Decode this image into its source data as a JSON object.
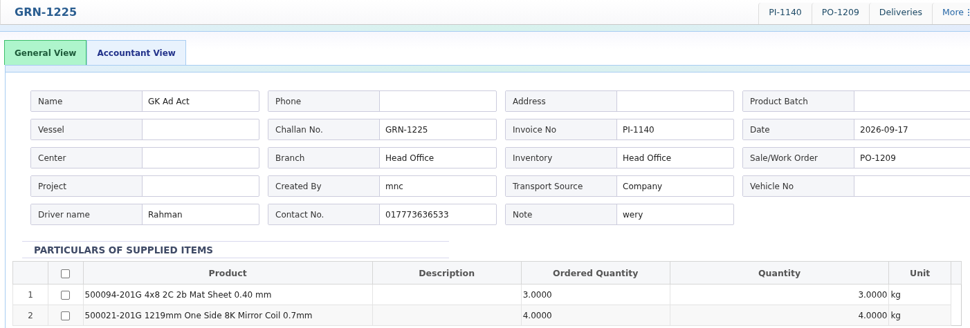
{
  "header": {
    "title": "GRN-1225",
    "links": [
      {
        "label": "PI-1140",
        "kind": "link"
      },
      {
        "label": "PO-1209",
        "kind": "link"
      },
      {
        "label": "Deliveries",
        "kind": "link"
      },
      {
        "label": "More",
        "kind": "menu"
      }
    ]
  },
  "tabs": [
    {
      "label": "General View",
      "selected": true
    },
    {
      "label": "Accountant View",
      "selected": false
    }
  ],
  "fields": [
    {
      "label": "Name",
      "value": "GK Ad Act"
    },
    {
      "label": "Phone"
    },
    {
      "label": "Address"
    },
    {
      "label": "Product Batch"
    },
    {
      "label": "Vessel"
    },
    {
      "label": "Challan No.",
      "value": "GRN-1225"
    },
    {
      "label": "Invoice No",
      "value": "PI-1140"
    },
    {
      "label": "Date",
      "value": "2026-09-17"
    },
    {
      "label": "Center"
    },
    {
      "label": "Branch",
      "value": "Head Office"
    },
    {
      "label": "Inventory",
      "value": "Head Office"
    },
    {
      "label": "Sale/Work Order",
      "value": "PO-1209"
    },
    {
      "label": "Project"
    },
    {
      "label": "Created By",
      "value": "mnc"
    },
    {
      "label": "Transport Source",
      "value": "Company"
    },
    {
      "label": "Vehicle No"
    },
    {
      "label": "Driver name",
      "value": "Rahman"
    },
    {
      "label": "Contact No.",
      "value": "017773636533"
    },
    {
      "label": "Note",
      "value": "wery"
    }
  ],
  "items": {
    "title": "PARTICULARS OF SUPPLIED ITEMS",
    "select_all": {
      "checked": false
    },
    "columns": [
      "Product",
      "Description",
      "Ordered Quantity",
      "Quantity",
      "Unit"
    ],
    "rows": [
      {
        "index": "1",
        "checked": false,
        "product": "500094-201G 4x8 2C 2b Mat Sheet 0.40 mm",
        "ordered": "3.0000",
        "quantity": "3.0000",
        "unit": "kg"
      },
      {
        "index": "2",
        "checked": false,
        "product": "500021-201G 1219mm One Side 8K Mirror Coil 0.7mm",
        "ordered": "4.0000",
        "quantity": "4.0000",
        "unit": "kg"
      }
    ]
  }
}
